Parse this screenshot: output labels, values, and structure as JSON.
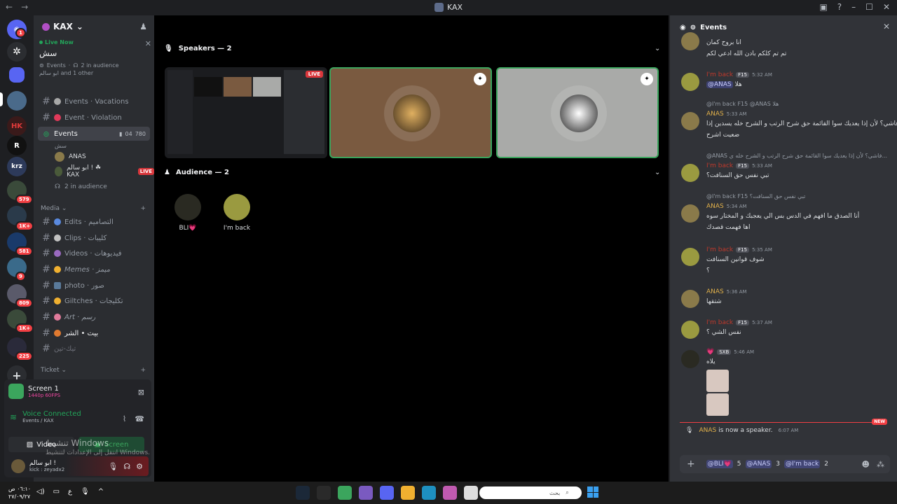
{
  "window": {
    "title": "KAX",
    "back": "←",
    "forward": "→"
  },
  "rail": {
    "badges": [
      "1",
      "579",
      "1K+",
      "581",
      "9",
      "809",
      "1K+",
      "225"
    ]
  },
  "server": {
    "name": "KAX"
  },
  "live_card": {
    "label": "Live Now",
    "channel": "سش",
    "event_name": "Events",
    "audience": "2 in audience",
    "members": "ابو سالم and 1 other"
  },
  "channels": [
    {
      "name": "Events · Vacations",
      "kind": "text"
    },
    {
      "name": "Event · Violation",
      "kind": "text"
    },
    {
      "name": "Events",
      "kind": "stage",
      "active": true,
      "count1": "04",
      "count2": "780"
    }
  ],
  "stage_voice": {
    "sub": "سش",
    "users": [
      {
        "name": "ANAS"
      },
      {
        "name": "ابو سالم ! ☘ KAX",
        "live": "LIVE"
      }
    ],
    "audience": "2 in audience"
  },
  "categories": {
    "media": "Media",
    "ticket": "Ticket"
  },
  "media_channels": [
    {
      "name": "Edits · التصاميم"
    },
    {
      "name": "Clips · كليبات"
    },
    {
      "name": "Videos · فيديوهات"
    },
    {
      "name": "Memes · ميمز"
    },
    {
      "name": "photo · صور"
    },
    {
      "name": "Giltches · تكليجات"
    },
    {
      "name": "Art · رسم"
    },
    {
      "name": "بيت • الشر"
    },
    {
      "name": "تيك-تين"
    }
  ],
  "panel": {
    "screen_title": "Screen 1",
    "screen_quality": "1440p 60FPS",
    "voice_status": "Voice Connected",
    "voice_channel": "Events / KAX",
    "video_btn": "Video",
    "screen_btn": "Screen",
    "user_name": "ابو سالم !",
    "user_status": "kick : zeyadx2"
  },
  "watermark": {
    "line1": "تنشيط Windows",
    "line2": "انتقل إلى الإعدادات لتنشيط Windows."
  },
  "stage": {
    "speakers_header": "Speakers — 2",
    "audience_header": "Audience — 2",
    "live_label": "LIVE",
    "audience_members": [
      {
        "name": "BLI💗"
      },
      {
        "name": "I'm back"
      }
    ]
  },
  "chat": {
    "header": "Events",
    "messages": [
      {
        "body_lines": [
          "انا بروح كمان",
          "تم تم كلكم بادن الله ادعي لكم"
        ]
      },
      {
        "name": "I'm back",
        "tag": "F15",
        "time": "5:32 AM",
        "body_mention": "@ANAS",
        "body": "هلا"
      },
      {
        "reply": "@I'm back  F15 @ANAS هلا",
        "name": "ANAS",
        "time": "5:33 AM",
        "body_lines": [
          "فاشي؟ لأن إذا يعديك سوا القائمة حق شرح الرتب و الشرح خله يسدين إذا",
          "ضعيت اشرح"
        ]
      },
      {
        "reply": "@ANAS فاشي؟ لأن إذا يعديك سوا القائمة حق شرح الرتب و الشرح خله ي...",
        "name": "I'm back",
        "tag": "F15",
        "time": "5:33 AM",
        "body": "تبي نفس حق السنافت؟"
      },
      {
        "reply": "@I'm back  F15 تبي نفس حق السنافت؟",
        "name": "ANAS",
        "time": "5:34 AM",
        "body_lines": [
          "أنا الصدق ما افهم في الدس بس الي يعجبك و المختار سوه",
          "اها فهمت قصدك"
        ]
      },
      {
        "name": "I'm back",
        "tag": "F15",
        "time": "5:35 AM",
        "body_lines": [
          "شوف قوانين السنافت",
          "؟"
        ]
      },
      {
        "name": "ANAS",
        "time": "5:36 AM",
        "body": "شتقها"
      },
      {
        "name": "I'm back",
        "tag": "F15",
        "time": "5:37 AM",
        "body": "نفس الشي ؟"
      },
      {
        "name": "💗",
        "tag": "SXB",
        "time": "5:46 AM",
        "body": "يلاه"
      }
    ],
    "new_label": "NEW",
    "system": {
      "name": "ANAS",
      "text": "is now a speaker.",
      "time": "6:07 AM"
    },
    "composer": {
      "mention1": "@BLI💗",
      "n1": "5",
      "mention2": "@ANAS",
      "n2": "3",
      "mention3": "@I'm back",
      "n3": "2"
    }
  },
  "taskbar": {
    "time": "٠٦:١٠ ص",
    "date": "٢٧/٠٩/٢٧",
    "lang": "ع",
    "search": "بحث"
  }
}
